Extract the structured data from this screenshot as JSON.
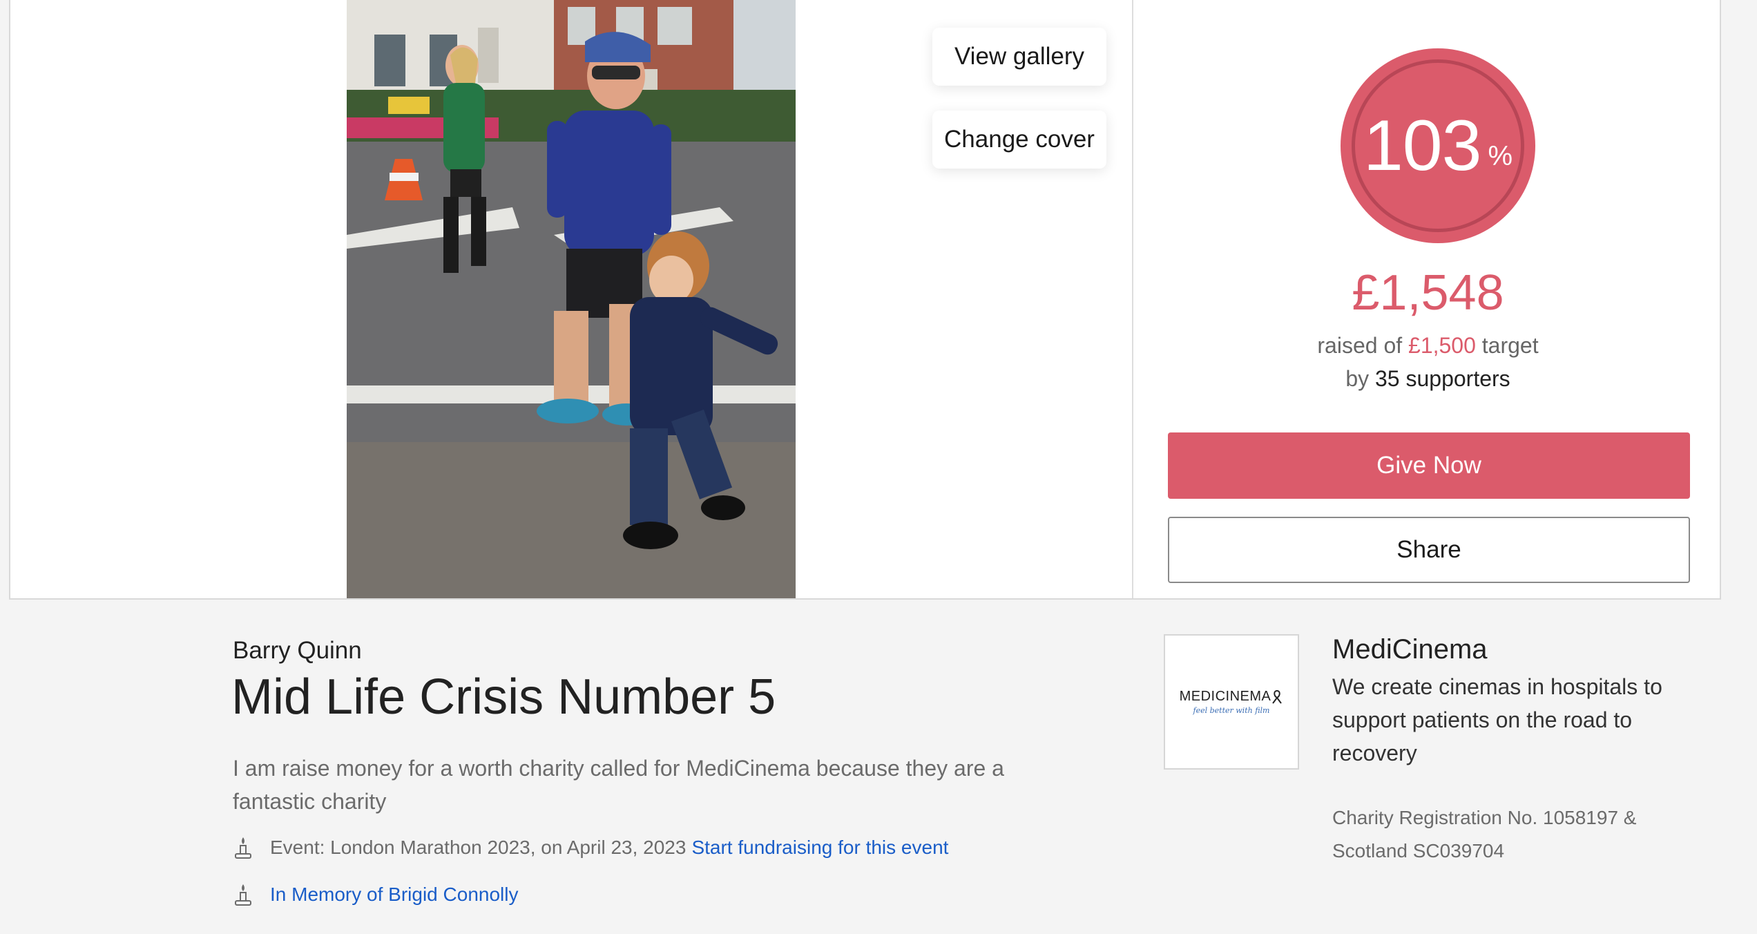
{
  "gallery": {
    "view_gallery_label": "View gallery",
    "change_cover_label": "Change cover"
  },
  "progress": {
    "percent": "103",
    "percent_sign": "%",
    "amount_raised": "£1,548",
    "raised_prefix": "raised of",
    "target": "£1,500",
    "target_suffix": "target",
    "supporters_prefix": "by",
    "supporters": "35 supporters",
    "give_label": "Give Now",
    "share_label": "Share",
    "accent_color": "#db5b6b"
  },
  "page": {
    "owner": "Barry Quinn",
    "title": "Mid Life Crisis Number 5",
    "description": "I am raise money for a worth charity called for MediCinema because they are a fantastic charity",
    "event_text": "Event: London Marathon 2023, on April 23, 2023",
    "event_link": "Start fundraising for this event",
    "memory_link": "In Memory of Brigid Connolly",
    "event_icon": "candle-icon",
    "link_color": "#1a5dc8"
  },
  "charity": {
    "logo_text": "MEDICINEMA",
    "logo_tagline": "feel better with film",
    "name": "MediCinema",
    "description": "We create cinemas in hospitals to support patients on the road to recovery",
    "registration": "Charity Registration No. 1058197 & Scotland SC039704"
  }
}
